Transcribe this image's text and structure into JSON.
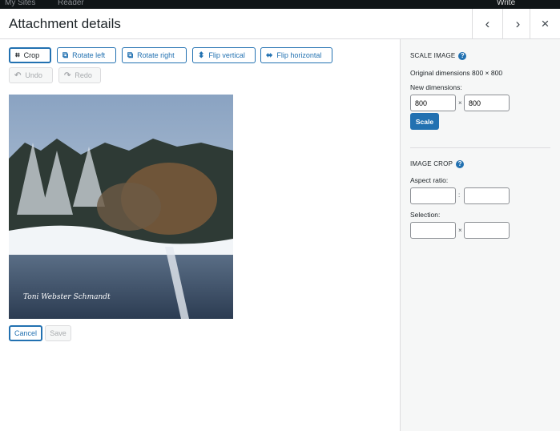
{
  "topbar": {
    "my_sites": "My Sites",
    "reader": "Reader",
    "write": "Write"
  },
  "header": {
    "title": "Attachment details",
    "prev_icon": "‹",
    "next_icon": "›",
    "close_icon": "×"
  },
  "toolbar": {
    "crop": "Crop",
    "rotate_left": "Rotate left",
    "rotate_right": "Rotate right",
    "flip_vertical": "Flip vertical",
    "flip_horizontal": "Flip horizontal",
    "undo": "Undo",
    "redo": "Redo"
  },
  "image": {
    "watermark": "Toni Webster Schmandt"
  },
  "actions": {
    "cancel": "Cancel",
    "save": "Save"
  },
  "sidebar": {
    "scale_title": "Scale Image",
    "original": "Original dimensions 800 × 800",
    "new_dimensions": "New dimensions:",
    "width": "800",
    "height": "800",
    "times": "×",
    "scale_button": "Scale",
    "crop_title": "Image Crop",
    "aspect_ratio": "Aspect ratio:",
    "colon": ":",
    "selection": "Selection:",
    "help": "?"
  },
  "colors": {
    "accent": "#2271b1",
    "topbar": "#101517",
    "sidebar_bg": "#f6f7f7"
  }
}
